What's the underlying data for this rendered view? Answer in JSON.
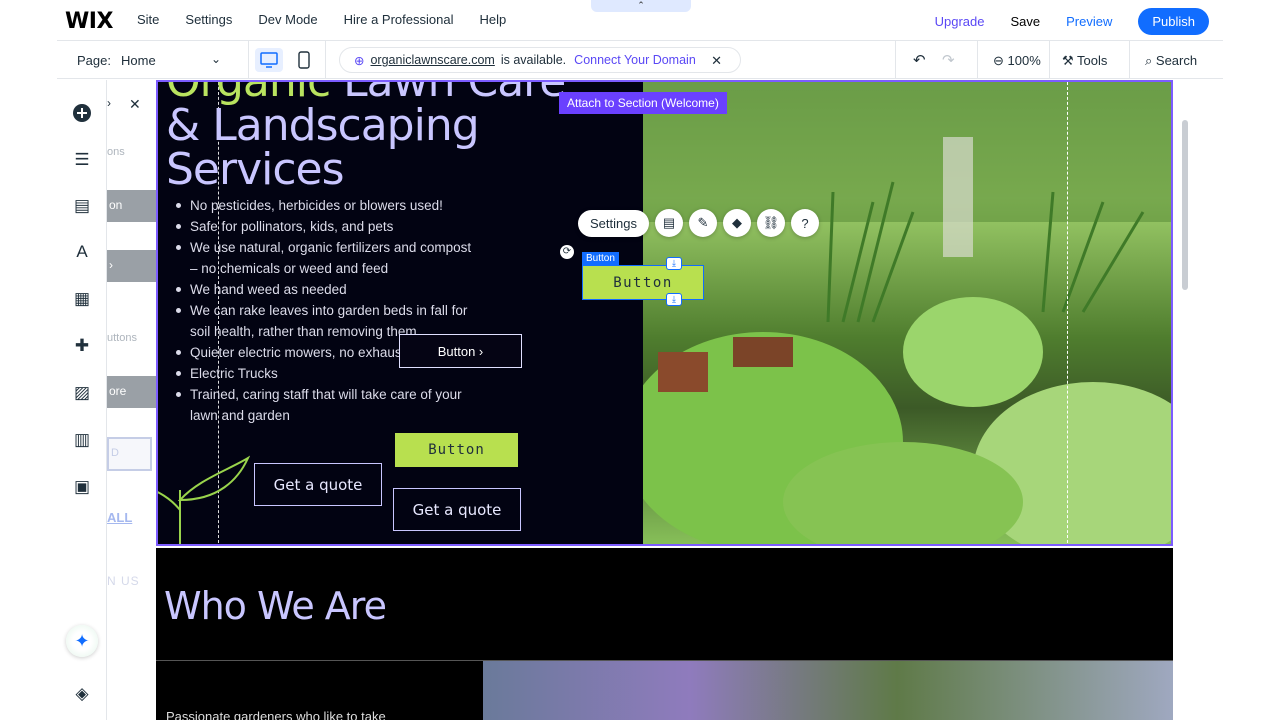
{
  "topbar": {
    "logo": "WIX",
    "nav": [
      "Site",
      "Settings",
      "Dev Mode",
      "Hire a Professional",
      "Help"
    ],
    "upgrade": "Upgrade",
    "save": "Save",
    "preview": "Preview",
    "publish": "Publish",
    "header_tab": "⌃"
  },
  "bar2": {
    "page_label": "Page:",
    "page_value": "Home",
    "url": "organiclawnscare.com",
    "available": "is available.",
    "connect": "Connect Your Domain",
    "zoom": "100%",
    "tools": "Tools",
    "search": "Search"
  },
  "addpanel": {
    "items": [
      "ons",
      "on",
      "›",
      "uttons",
      "ore",
      "D",
      "ALL",
      "N US"
    ]
  },
  "hero": {
    "title_line0_green": "Organic",
    "title_line0_rest": " Lawn Care",
    "title_line1": "& Landscaping",
    "title_line2": "Services",
    "bullets": [
      "No pesticides, herbicides or blowers used!",
      "Safe for pollinators, kids, and pets",
      "We use natural, organic fertilizers and compost – no chemicals or weed and feed",
      "We hand weed as needed",
      "We can rake leaves into garden beds in fall for soil health, rather than removing them",
      "Quieter electric mowers, no exhaust",
      "Electric Trucks",
      "Trained, caring staff that will take care of your lawn and garden"
    ],
    "button_arrow": "Button",
    "button_green": "Button",
    "button_selected": "Button",
    "selected_tag": "Button",
    "quote1": "Get a quote",
    "quote2": "Get a quote",
    "attach": "Attach to Section (Welcome)",
    "toolbar_settings": "Settings"
  },
  "who": {
    "heading": "Who We Are",
    "subtext": "Passionate gardeners who like to take"
  },
  "icons": [
    "plus-icon",
    "menu-icon",
    "page-icon",
    "paint-icon",
    "apps-icon",
    "puzzle-icon",
    "image-icon",
    "table-icon",
    "briefcase-icon",
    "layers-icon",
    "ai-sparkle-icon"
  ],
  "colors": {
    "accent": "#116dff",
    "purple": "#5a48f5",
    "green": "#b8e04f",
    "lavender": "#c9c6ff"
  }
}
